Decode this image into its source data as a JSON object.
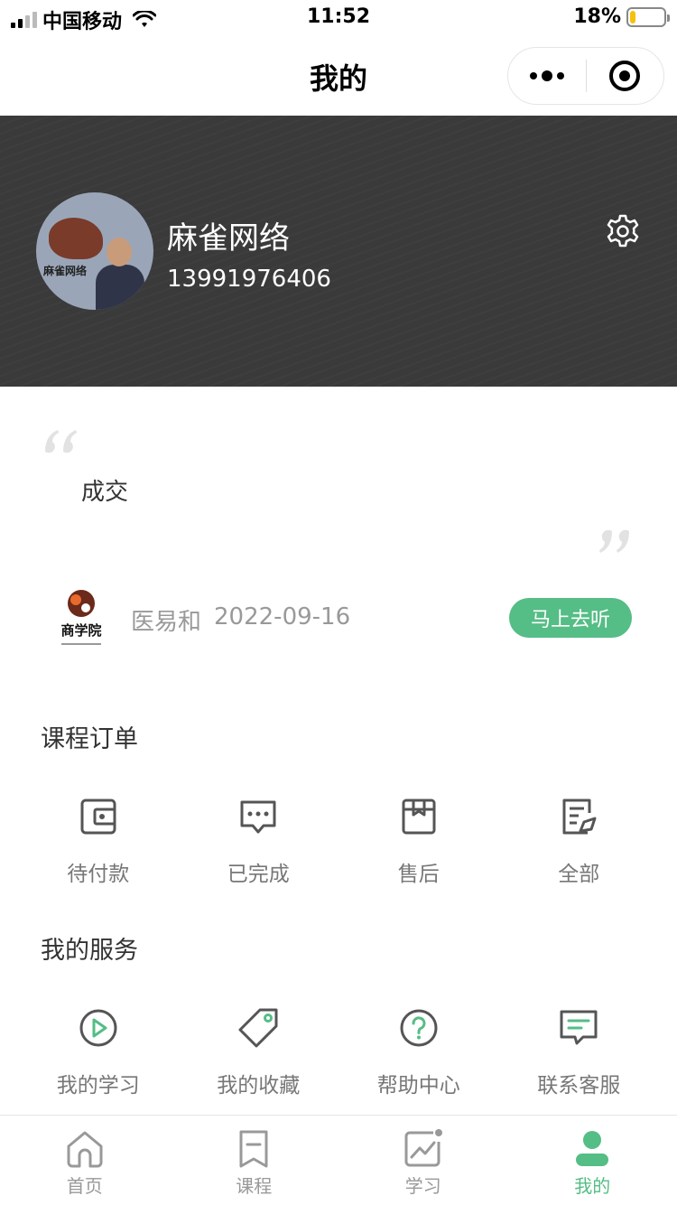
{
  "status_bar": {
    "carrier": "中国移动",
    "time": "11:52",
    "battery": "18%",
    "battery_level": 0.18
  },
  "nav": {
    "title": "我的"
  },
  "profile": {
    "name": "麻雀网络",
    "phone": "13991976406",
    "avatar_text": "麻雀网络"
  },
  "quote": {
    "text": "成交"
  },
  "course": {
    "logo_text": "商学院",
    "teacher": "医易和",
    "date": "2022-09-16",
    "button": "马上去听"
  },
  "orders": {
    "title": "课程订单",
    "items": [
      {
        "label": "待付款",
        "icon": "wallet-icon"
      },
      {
        "label": "已完成",
        "icon": "chat-dots-icon"
      },
      {
        "label": "售后",
        "icon": "box-icon"
      },
      {
        "label": "全部",
        "icon": "document-icon"
      }
    ]
  },
  "services": {
    "title": "我的服务",
    "items": [
      {
        "label": "我的学习",
        "icon": "play-circle-icon"
      },
      {
        "label": "我的收藏",
        "icon": "tag-icon"
      },
      {
        "label": "帮助中心",
        "icon": "help-circle-icon"
      },
      {
        "label": "联系客服",
        "icon": "message-icon"
      }
    ]
  },
  "tabs": [
    {
      "label": "首页",
      "icon": "home-icon"
    },
    {
      "label": "课程",
      "icon": "bookmark-icon"
    },
    {
      "label": "学习",
      "icon": "chart-icon"
    },
    {
      "label": "我的",
      "icon": "user-icon",
      "active": true
    }
  ],
  "colors": {
    "accent": "#55bd86",
    "header_bg": "#3a3a3a"
  }
}
